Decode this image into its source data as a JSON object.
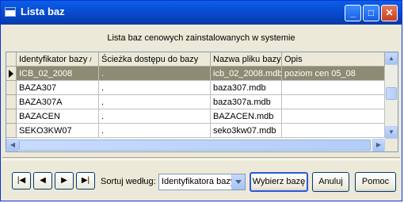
{
  "window": {
    "title": "Lista baz"
  },
  "header": {
    "text": "Lista baz cenowych zainstalowanych w systemie"
  },
  "grid": {
    "columns": [
      "Identyfikator bazy",
      "Ścieżka dostępu do bazy",
      "Nazwa pliku bazy",
      "Opis"
    ],
    "sort_glyph": "/",
    "rows": [
      {
        "id": "ICB_02_2008",
        "path": ".",
        "file": "icb_02_2008.mdb",
        "desc": "poziom cen 05_08",
        "selected": true
      },
      {
        "id": "BAZA307",
        "path": ".",
        "file": "baza307.mdb",
        "desc": ""
      },
      {
        "id": "BAZA307A",
        "path": ".",
        "file": "baza307a.mdb",
        "desc": ""
      },
      {
        "id": "BAZACEN",
        "path": ".",
        "file": "BAZACEN.mdb",
        "desc": ""
      },
      {
        "id": "SEKO3KW07",
        "path": ".",
        "file": "seko3kw07.mdb",
        "desc": ""
      }
    ]
  },
  "nav": {
    "first": "|◀",
    "prev": "◀",
    "next": "▶",
    "last": "▶|"
  },
  "sort": {
    "label": "Sortuj według:",
    "value": "Identyfikatora bazy"
  },
  "buttons": {
    "select": "Wybierz bazę",
    "cancel": "Anuluj",
    "help": "Pomoc"
  },
  "colors": {
    "selected_row": "#8c8c74",
    "titlebar": "#0847c8"
  }
}
